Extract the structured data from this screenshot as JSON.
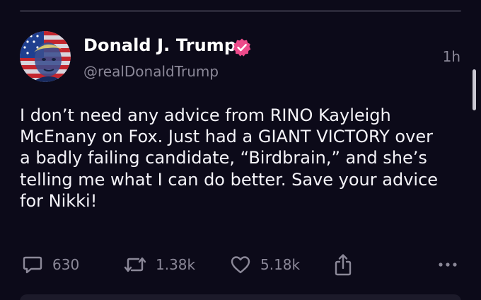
{
  "author": {
    "display_name": "Donald J. Trump",
    "handle": "@realDonaldTrump",
    "verified": true,
    "avatar_icon": "flag-portrait-avatar"
  },
  "post": {
    "timestamp": "1h",
    "text_lines": [
      "I don’t need any advice from RINO Kayleigh",
      "McEnany on Fox. Just had a GIANT VICTORY over",
      "a badly failing candidate, “Birdbrain,” and she’s",
      "telling me what I can do better. Save your advice",
      "for Nikki!"
    ]
  },
  "actions": {
    "replies": "630",
    "reposts": "1.38k",
    "likes": "5.18k"
  },
  "colors": {
    "background": "#0c0a19",
    "text": "#f4f3f8",
    "muted": "#8b8898",
    "verified_badge": "#ec4a8a"
  }
}
